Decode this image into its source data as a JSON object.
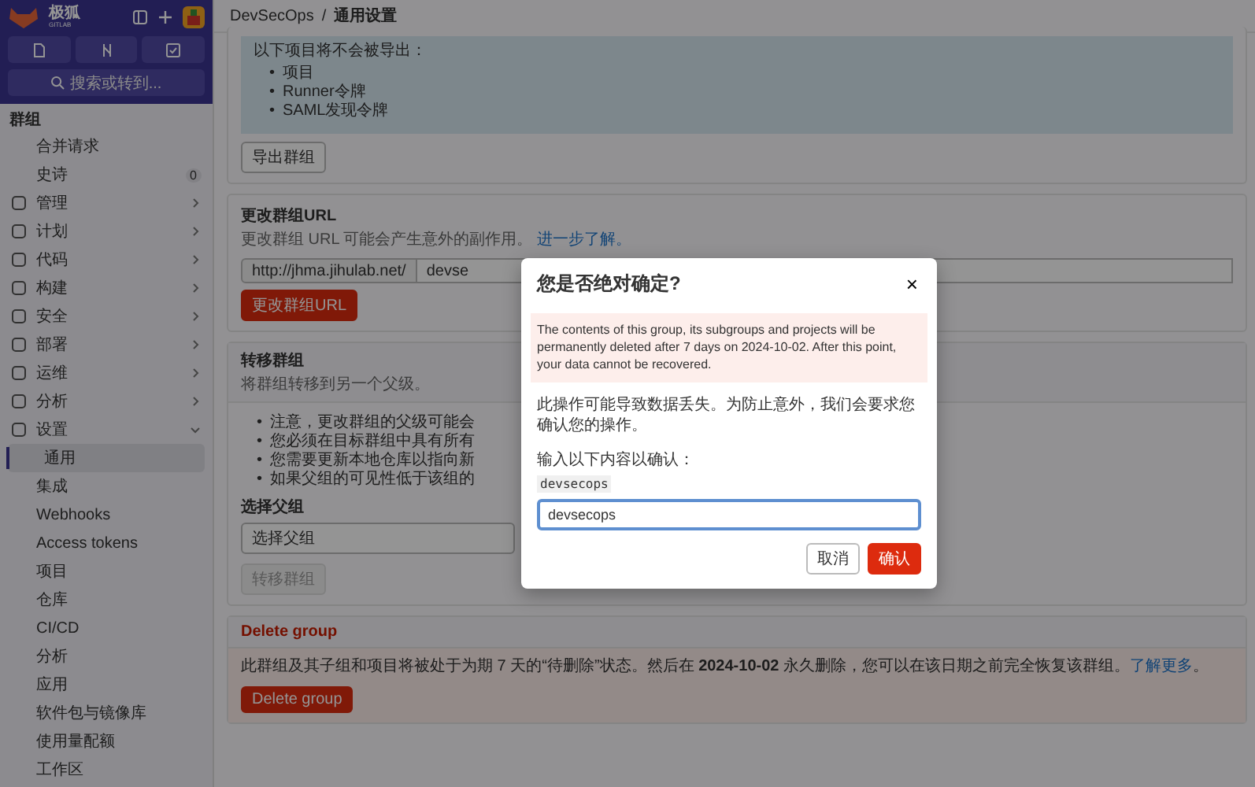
{
  "brand": {
    "name": "极狐",
    "sub": "GITLAB"
  },
  "search": {
    "label": "搜索或转到..."
  },
  "sidebar": {
    "heading": "群组",
    "top_items": [
      {
        "label": "合并请求"
      },
      {
        "label": "史诗",
        "count": "0"
      }
    ],
    "items": [
      {
        "label": "管理",
        "expanded": false
      },
      {
        "label": "计划",
        "expanded": false
      },
      {
        "label": "代码",
        "expanded": false
      },
      {
        "label": "构建",
        "expanded": false
      },
      {
        "label": "安全",
        "expanded": false
      },
      {
        "label": "部署",
        "expanded": false
      },
      {
        "label": "运维",
        "expanded": false
      },
      {
        "label": "分析",
        "expanded": false
      },
      {
        "label": "设置",
        "expanded": true,
        "children": [
          {
            "label": "通用",
            "selected": true
          },
          {
            "label": "集成",
            "selected": false
          },
          {
            "label": "Webhooks",
            "selected": false
          },
          {
            "label": "Access tokens",
            "selected": false
          },
          {
            "label": "项目",
            "selected": false
          },
          {
            "label": "仓库",
            "selected": false
          },
          {
            "label": "CI/CD",
            "selected": false
          },
          {
            "label": "分析",
            "selected": false
          },
          {
            "label": "应用",
            "selected": false
          },
          {
            "label": "软件包与镜像库",
            "selected": false
          },
          {
            "label": "使用量配额",
            "selected": false
          },
          {
            "label": "工作区",
            "selected": false
          }
        ]
      }
    ]
  },
  "breadcrumb": [
    "DevSecOps",
    "/",
    "通用设置"
  ],
  "bullet": "•",
  "export": {
    "intro": "以下项目将不会被导出：",
    "list": [
      "项目",
      "Runner令牌",
      "SAML发现令牌"
    ],
    "button": "导出群组"
  },
  "change_url": {
    "title": "更改群组URL",
    "description": "更改群组 URL 可能会产生意外的副作用。",
    "link": "进一步了解。",
    "prefix": "http://jhma.jihulab.net/",
    "value": "devse",
    "button": "更改群组URL"
  },
  "transfer": {
    "title": "转移群组",
    "description": "将群组转移到另一个父级。",
    "notes": [
      "注意，更改群组的父级可能会",
      "您必须在目标群组中具有所有",
      "您需要更新本地仓库以指向新",
      "如果父组的可见性低于该组的"
    ],
    "select_label": "选择父组",
    "select_value": "选择父组",
    "button": "转移群组",
    "button_disabled": true
  },
  "delete": {
    "title": "Delete group",
    "text": "此群组及其子组和项目将被处于为期 7 天的“待删除”状态。然后在 **2024-10-02** 永久删除，您可以在该日期之前完全恢复该群组。",
    "link": "了解更多",
    "after": "。",
    "button": "Delete group"
  },
  "modal": {
    "title": "您是否绝对确定?",
    "close": "×",
    "alert": "The contents of this group, its subgroups and projects will be permanently deleted after 7 days on 2024-10-02. After this point, your data cannot be recovered.",
    "warning": "此操作可能导致数据丢失。为防止意外，我们会要求您确认您的操作。",
    "confirm_label": "输入以下内容以确认：",
    "confirm_code": "devsecops",
    "input_value": "devsecops",
    "cancel": "取消",
    "ok": "确认"
  }
}
